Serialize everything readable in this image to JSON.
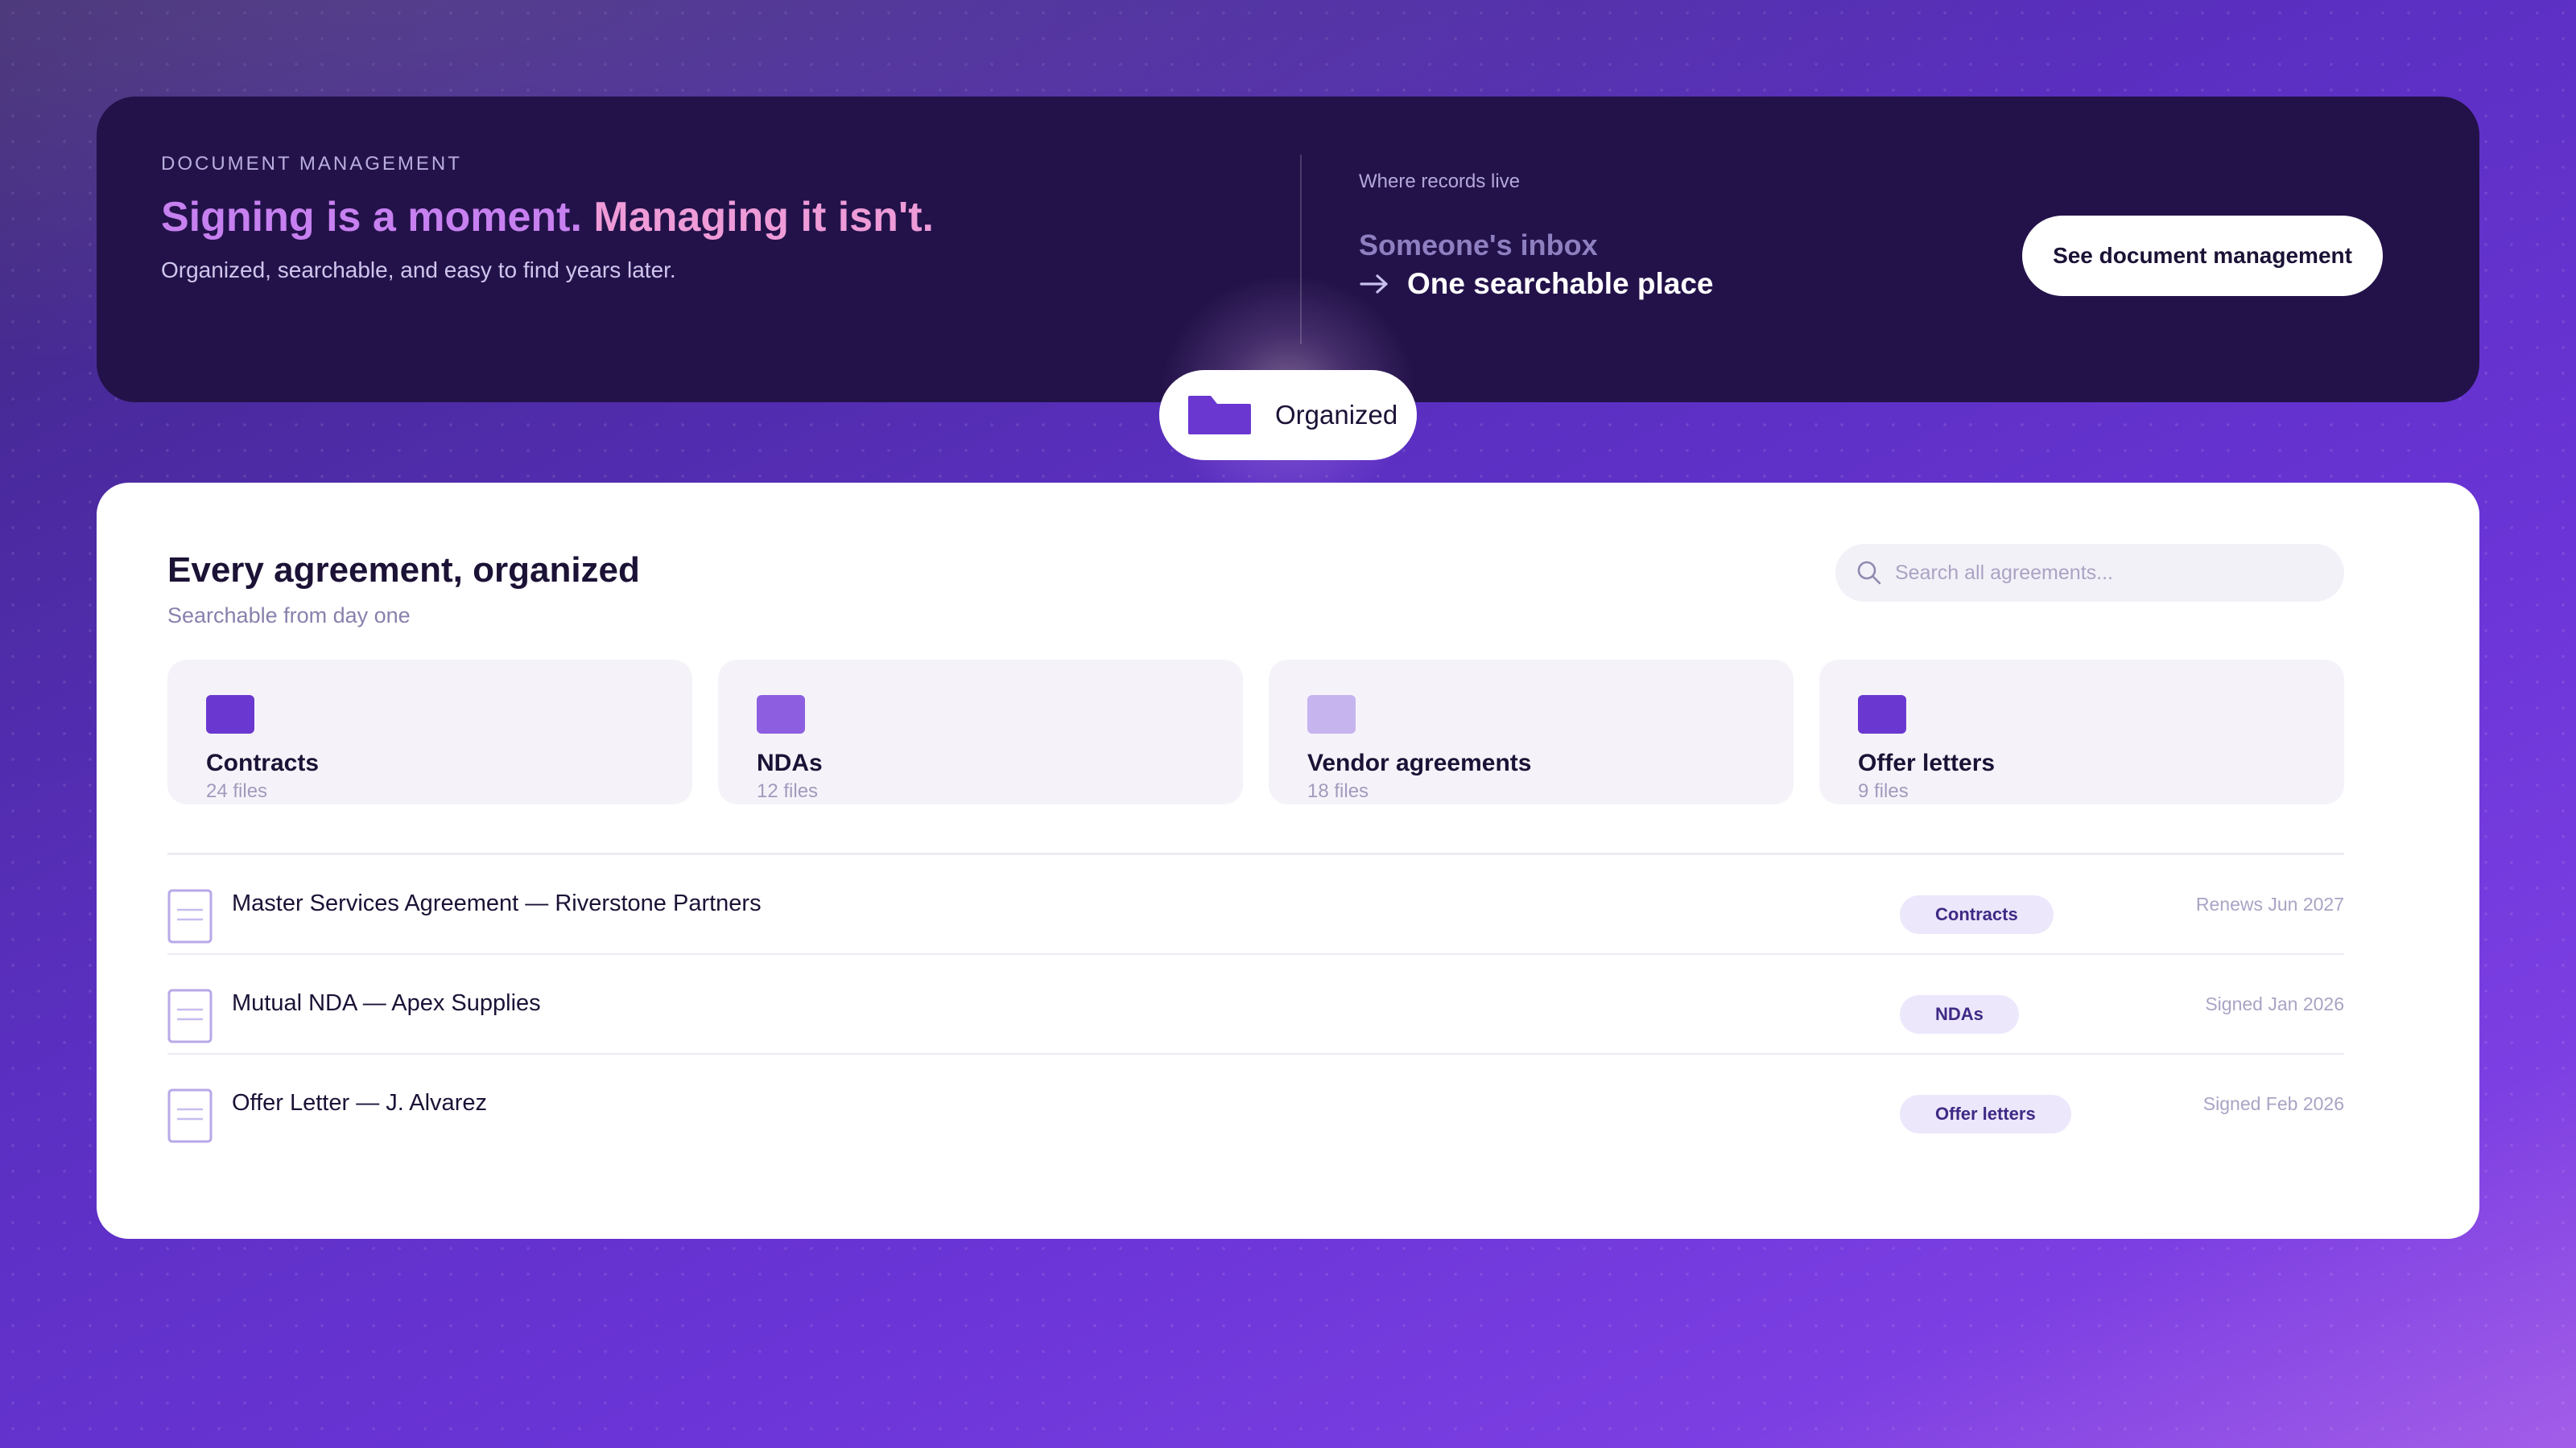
{
  "hero": {
    "eyebrow": "DOCUMENT MANAGEMENT",
    "title_part1": "Signing is a moment.",
    "title_part2": "Managing it isn't.",
    "subtitle": "Organized, searchable, and easy to find years later.",
    "records_label": "Where records live",
    "records_old": "Someone's inbox",
    "records_new": "One searchable place",
    "records_new_icon": "arrow-right-icon",
    "cta_label": "See document management"
  },
  "pill": {
    "icon": "folder-icon",
    "label": "Organized"
  },
  "panel": {
    "title": "Every agreement, organized",
    "subtitle": "Searchable from day one",
    "search": {
      "icon": "search-icon",
      "placeholder": "Search all agreements..."
    },
    "categories": [
      {
        "name": "Contracts",
        "count": "24 files",
        "color": "#6a38d0"
      },
      {
        "name": "NDAs",
        "count": "12 files",
        "color": "#8d5fe0"
      },
      {
        "name": "Vendor agreements",
        "count": "18 files",
        "color": "#c6b4ef"
      },
      {
        "name": "Offer letters",
        "count": "9 files",
        "color": "#6a38d0"
      }
    ],
    "documents": [
      {
        "title": "Master Services Agreement — Riverstone Partners",
        "tag": "Contracts",
        "date": "Renews Jun 2027",
        "icon": "document-icon"
      },
      {
        "title": "Mutual NDA — Apex Supplies",
        "tag": "NDAs",
        "date": "Signed Jan 2026",
        "icon": "document-icon"
      },
      {
        "title": "Offer Letter — J. Alvarez",
        "tag": "Offer letters",
        "date": "Signed Feb 2026",
        "icon": "document-icon"
      }
    ]
  },
  "colors": {
    "hero_bg": "#23124a",
    "accent_purple": "#6a38d0",
    "badge_bg": "#ece7fb",
    "title_pink": "#ee9bd8",
    "title_violet": "#c780f0"
  }
}
